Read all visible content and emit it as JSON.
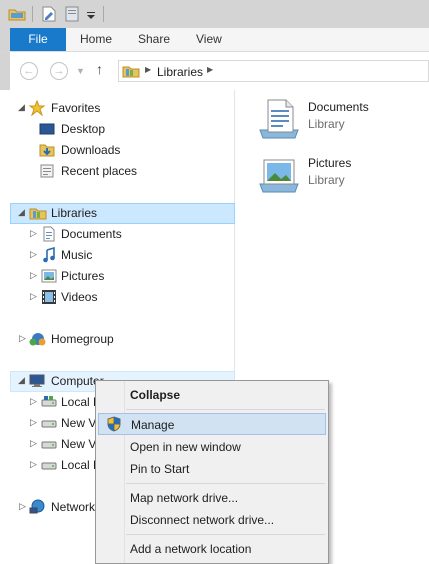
{
  "ribbon": {
    "file": "File",
    "tabs": [
      "Home",
      "Share",
      "View"
    ]
  },
  "address": {
    "path": "Libraries"
  },
  "nav": {
    "favorites": "Favorites",
    "favorites_items": [
      "Desktop",
      "Downloads",
      "Recent places"
    ],
    "libraries": "Libraries",
    "libraries_items": [
      "Documents",
      "Music",
      "Pictures",
      "Videos"
    ],
    "homegroup": "Homegroup",
    "computer": "Computer",
    "computer_items": [
      "Local D",
      "New V",
      "New V",
      "Local D"
    ],
    "network": "Network"
  },
  "content": {
    "items": [
      {
        "name": "Documents",
        "type": "Library"
      },
      {
        "name": "Pictures",
        "type": "Library"
      }
    ]
  },
  "menu": {
    "items": [
      "Collapse",
      "Manage",
      "Open in new window",
      "Pin to Start",
      "Map network drive...",
      "Disconnect network drive...",
      "Add a network location"
    ]
  },
  "colors": {
    "accent": "#1979ca",
    "selection": "#cce8ff",
    "menu_highlight": "#d1e3f3"
  }
}
